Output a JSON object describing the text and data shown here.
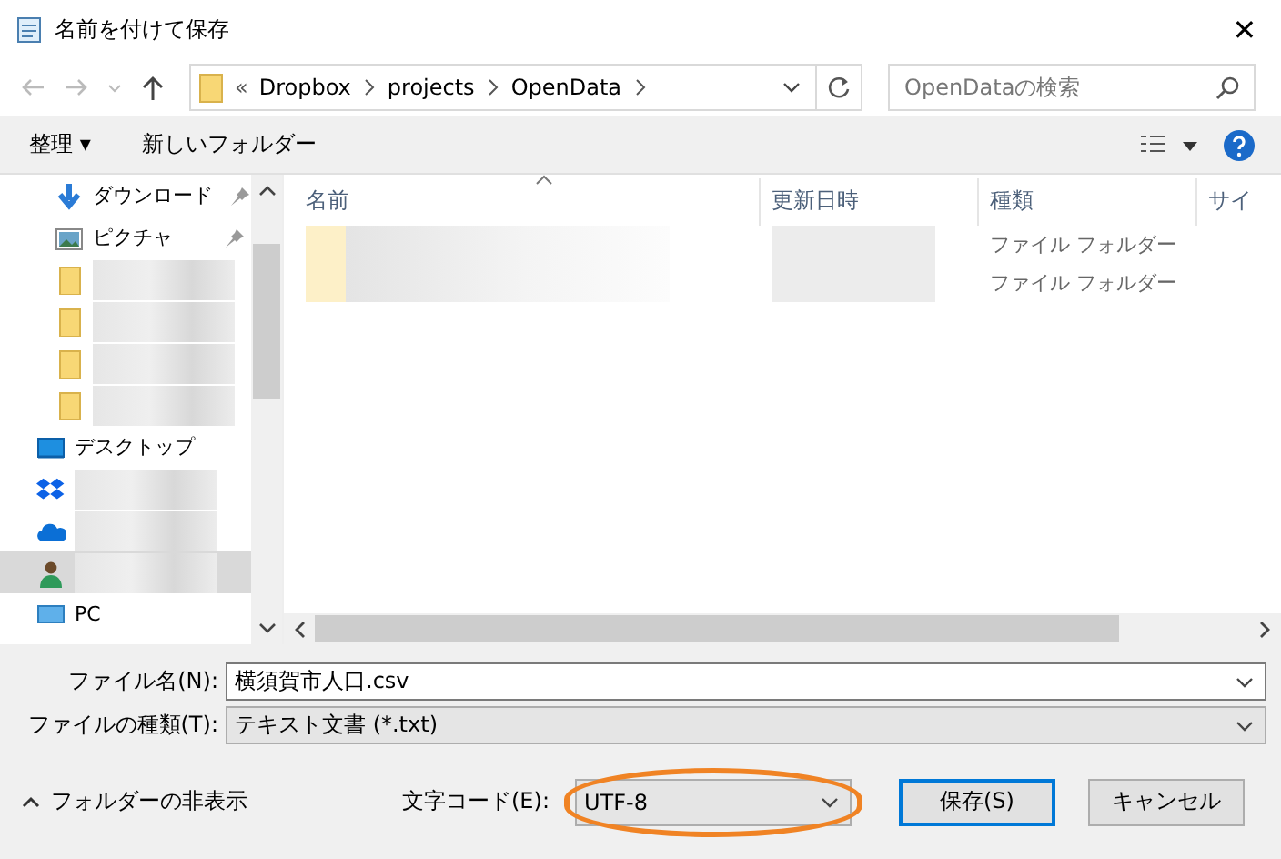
{
  "window": {
    "title": "名前を付けて保存",
    "close": "✕"
  },
  "address": {
    "prefix": "«",
    "path": [
      "Dropbox",
      "projects",
      "OpenData"
    ],
    "search_placeholder": "OpenDataの検索"
  },
  "toolbar": {
    "organize": "整理 ▾",
    "new_folder": "新しいフォルダー"
  },
  "nav": [
    {
      "kind": "download",
      "label": "ダウンロード",
      "pinned": true,
      "selected": false
    },
    {
      "kind": "picture",
      "label": "ピクチャ",
      "pinned": true,
      "selected": false
    },
    {
      "kind": "folder",
      "blurred": true,
      "selected": false
    },
    {
      "kind": "folder",
      "blurred": true,
      "selected": false
    },
    {
      "kind": "folder",
      "blurred": true,
      "selected": false
    },
    {
      "kind": "folder",
      "blurred": true,
      "selected": false
    },
    {
      "kind": "desktop",
      "label": "デスクトップ",
      "pinned": false,
      "selected": false
    },
    {
      "kind": "dropbox",
      "blurred": true,
      "selected": false
    },
    {
      "kind": "onedrive",
      "blurred": true,
      "selected": false
    },
    {
      "kind": "user",
      "blurred": true,
      "selected": true
    },
    {
      "kind": "pc",
      "label": "PC",
      "pinned": false,
      "selected": false
    }
  ],
  "table": {
    "columns": [
      "名前",
      "更新日時",
      "種類",
      "サイ"
    ],
    "rows": [
      {
        "type": "ファイル フォルダー"
      },
      {
        "type": "ファイル フォルダー"
      }
    ]
  },
  "form": {
    "filename_label": "ファイル名(N):",
    "filename": "横須賀市人口.csv",
    "filetype_label": "ファイルの種類(T):",
    "filetype": "テキスト文書 (*.txt)"
  },
  "footer": {
    "hide_folders": "フォルダーの非表示",
    "encoding_label": "文字コード(E):",
    "encoding": "UTF-8",
    "encoding_highlighted": true,
    "save": "保存(S)",
    "cancel": "キャンセル"
  }
}
